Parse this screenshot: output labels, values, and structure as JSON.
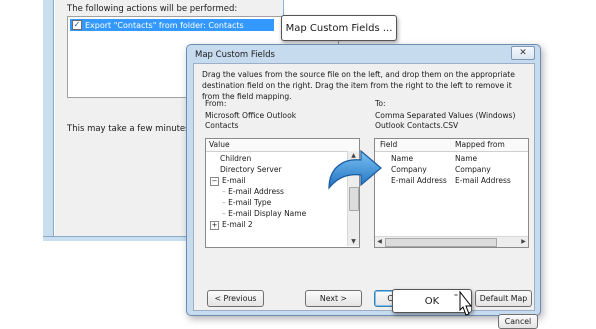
{
  "wizard": {
    "actions_label": "The following actions will be performed:",
    "action_item": "Export \"Contacts\" from folder: Contacts",
    "footer_text": "This may take a few minutes an"
  },
  "callout": {
    "map_button_label": "Map Custom Fields ..."
  },
  "dialog": {
    "title": "Map Custom Fields",
    "close_symbol": "✕",
    "instructions": "Drag the values from the source file on the left, and drop them on the appropriate destination field on the right.  Drag the item from the right to the left to remove it from the field mapping.",
    "from": {
      "label": "From:",
      "source": "Microsoft Office Outlook",
      "folder": "Contacts",
      "column_header": "Value",
      "items": [
        {
          "expander": "",
          "text": "Children"
        },
        {
          "expander": "",
          "text": "Directory Server"
        },
        {
          "expander": "⊟",
          "text": "E-mail"
        },
        {
          "expander": "",
          "text": "E-mail Address"
        },
        {
          "expander": "",
          "text": "E-mail Type"
        },
        {
          "expander": "",
          "text": "E-mail Display Name"
        },
        {
          "expander": "⊞",
          "text": "E-mail 2"
        }
      ]
    },
    "to": {
      "label": "To:",
      "target": "Comma Separated Values (Windows)",
      "file": "Outlook Contacts.CSV",
      "headers": {
        "field": "Field",
        "mapped": "Mapped from"
      },
      "rows": [
        {
          "field": "Name",
          "mapped": "Name"
        },
        {
          "field": "Company",
          "mapped": "Company"
        },
        {
          "field": "E-mail Address",
          "mapped": "E-mail Address"
        }
      ]
    },
    "buttons": {
      "previous": "< Previous",
      "next": "Next >",
      "clear_map": "Clear Map",
      "default_map": "Default Map",
      "ok": "OK",
      "cancel": "Cancel"
    }
  },
  "colors": {
    "selection": "#3399ff",
    "dialog_frame": "#c7dbef",
    "drag_arrow": "#2f8fd8"
  }
}
